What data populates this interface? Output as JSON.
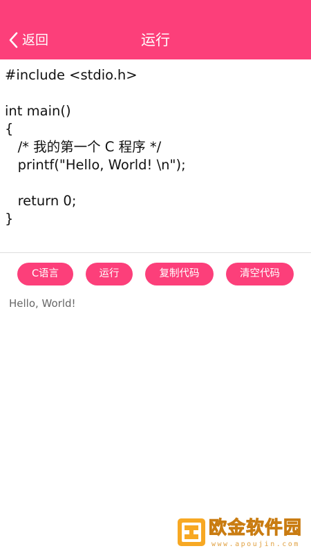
{
  "header": {
    "back_label": "返回",
    "title": "运行",
    "background_color": "#fc3f7a"
  },
  "editor": {
    "code": "#include <stdio.h>\n\nint main()\n{\n   /* 我的第一个 C 程序 */\n   printf(\"Hello, World! \\n\");\n\n   return 0;\n}"
  },
  "buttons": {
    "language": "C语言",
    "run": "运行",
    "copy": "复制代码",
    "clear": "清空代码"
  },
  "output": {
    "text": "Hello, World!"
  },
  "watermark": {
    "name": "欧金软件园",
    "url": "www.apoujin.com"
  }
}
